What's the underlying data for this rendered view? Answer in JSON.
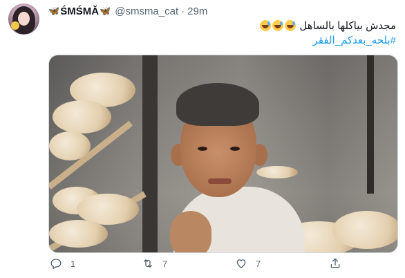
{
  "tweet": {
    "display_name_left_symbol": "🦋",
    "display_name": "ŚMŚMĂ",
    "display_name_right_symbol": "🦋",
    "handle": "@smsma_cat",
    "separator": "·",
    "time": "29m",
    "text_line_1": "مجدش بياكلها بالساهل",
    "hashtag": "#بلحه_بعدكم_الفقر",
    "emojis": [
      "grinning-sweat-emoji",
      "grinning-sweat-emoji",
      "grinning-sweat-emoji"
    ]
  },
  "actions": {
    "reply_count": "1",
    "retweet_count": "7",
    "like_count": "7"
  },
  "colors": {
    "accent": "#1d9bf0",
    "secondary_text": "#536471",
    "primary_text": "#0f1419"
  }
}
